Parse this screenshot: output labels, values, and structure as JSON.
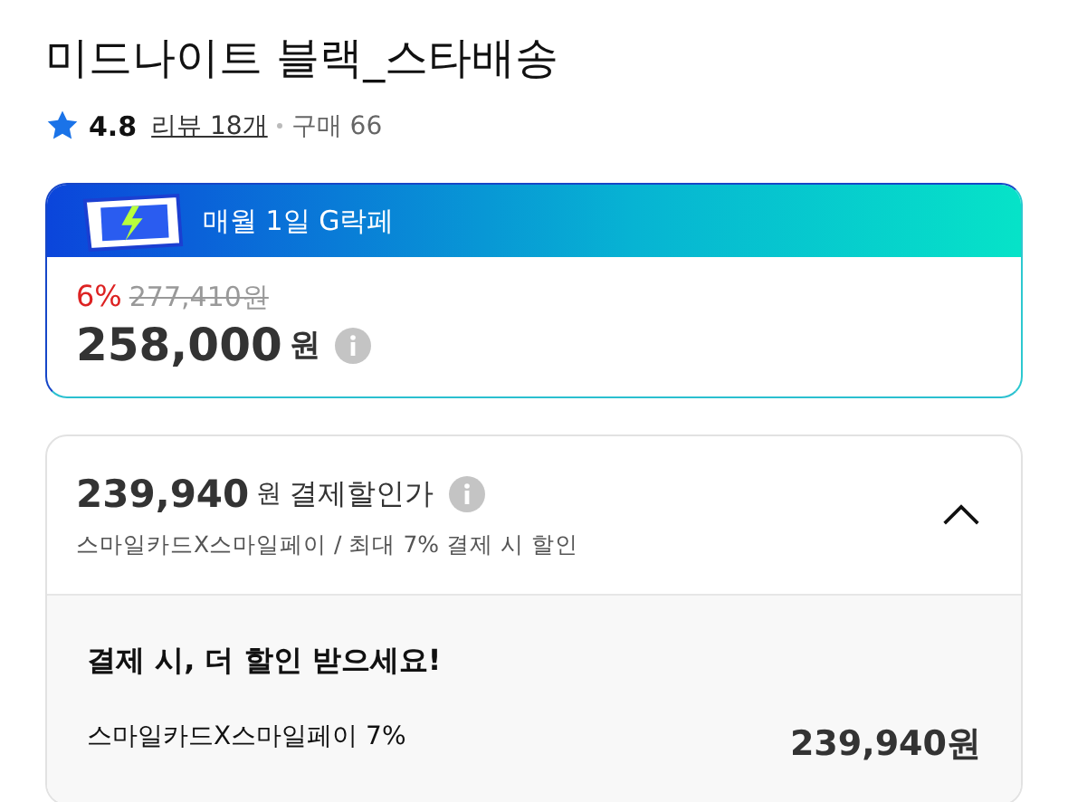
{
  "product": {
    "title": "미드나이트 블랙_스타배송",
    "rating": "4.8",
    "reviews": "리뷰 18개",
    "purchases": "구매 66"
  },
  "promo": {
    "banner": "매월 1일 G락페",
    "discount": "6%",
    "original_price": "277,410원",
    "price": "258,000",
    "currency": "원"
  },
  "payment": {
    "price": "239,940",
    "currency": "원",
    "label": "결제할인가",
    "subtitle": "스마일카드X스마일페이 / 최대 7% 결제 시 할인",
    "expanded": true,
    "detail_title": "결제 시, 더 할인 받으세요!",
    "offers": [
      {
        "name": "스마일카드X스마일페이 7%",
        "price": "239,940원"
      }
    ]
  }
}
